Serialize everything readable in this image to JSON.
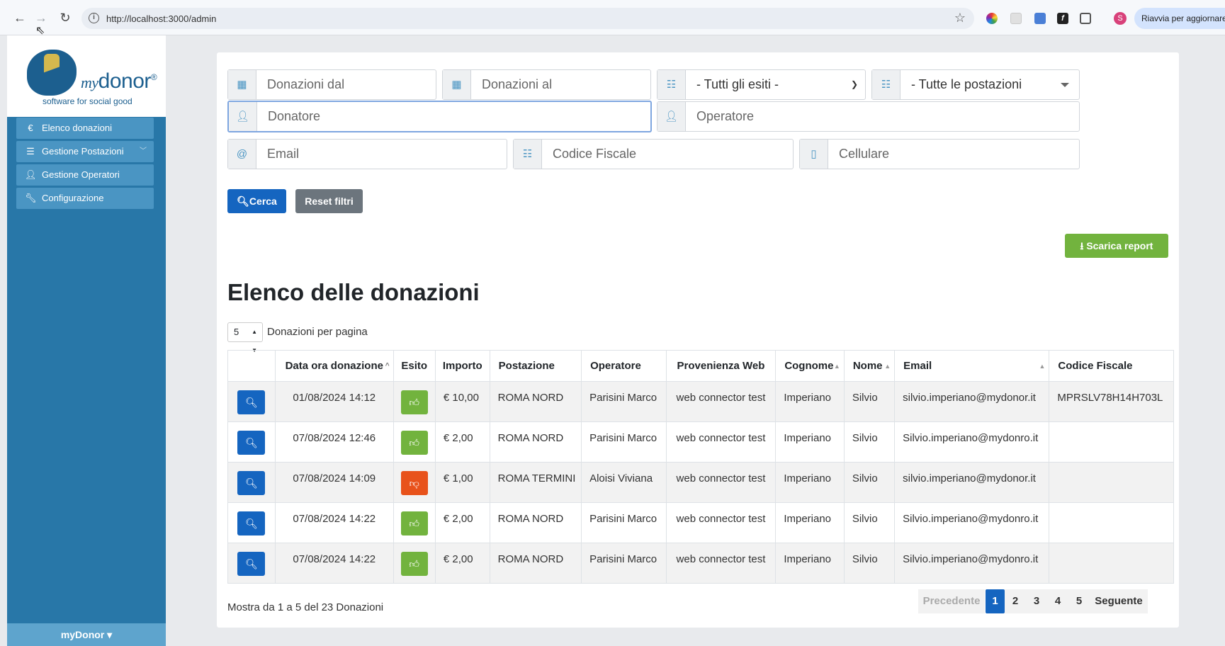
{
  "browser": {
    "url": "http://localhost:3000/admin",
    "relaunch_label": "Riavvia per aggiornare",
    "profile_initial": "S"
  },
  "sidebar": {
    "logo_my": "my",
    "logo_brand": "donor",
    "logo_mark": "®",
    "tagline": "software for social good",
    "items": [
      {
        "label": "Elenco donazioni",
        "icon": "euro-icon"
      },
      {
        "label": "Gestione Postazioni",
        "icon": "list-icon"
      },
      {
        "label": "Gestione Operatori",
        "icon": "user-icon"
      },
      {
        "label": "Configurazione",
        "icon": "wrench-icon"
      }
    ],
    "footer": "myDonor ▾"
  },
  "filters": {
    "date_from": "Donazioni dal",
    "date_to": "Donazioni al",
    "outcome_selected": "- Tutti gli esiti -",
    "station_selected": "- Tutte le postazioni",
    "donor_placeholder": "Donatore",
    "operator_placeholder": "Operatore",
    "email_placeholder": "Email",
    "tax_code_placeholder": "Codice Fiscale",
    "mobile_placeholder": "Cellulare",
    "search_label": "Cerca",
    "reset_label": "Reset filtri"
  },
  "report_label": "Scarica report",
  "title": "Elenco delle donazioni",
  "per_page": {
    "value": "5",
    "label": "Donazioni per pagina"
  },
  "table": {
    "headers": [
      "",
      "Data ora donazione",
      "Esito",
      "Importo",
      "Postazione",
      "Operatore",
      "Provenienza Web",
      "Cognome",
      "Nome",
      "Email",
      "Codice Fiscale"
    ],
    "rows": [
      {
        "date": "01/08/2024 14:12",
        "outcome": "ok",
        "amount": "€ 10,00",
        "station": "ROMA NORD",
        "operator": "Parisini Marco",
        "source": "web connector test",
        "surname": "Imperiano",
        "name": "Silvio",
        "email": "silvio.imperiano@mydonor.it",
        "tax_code": "MPRSLV78H14H703L"
      },
      {
        "date": "07/08/2024 12:46",
        "outcome": "ok",
        "amount": "€ 2,00",
        "station": "ROMA NORD",
        "operator": "Parisini Marco",
        "source": "web connector test",
        "surname": "Imperiano",
        "name": "Silvio",
        "email": "Silvio.imperiano@mydonro.it",
        "tax_code": ""
      },
      {
        "date": "07/08/2024 14:09",
        "outcome": "ko",
        "amount": "€ 1,00",
        "station": "ROMA TERMINI",
        "operator": "Aloisi Viviana",
        "source": "web connector test",
        "surname": "Imperiano",
        "name": "Silvio",
        "email": "silvio.imperiano@mydonor.it",
        "tax_code": ""
      },
      {
        "date": "07/08/2024 14:22",
        "outcome": "ok",
        "amount": "€ 2,00",
        "station": "ROMA NORD",
        "operator": "Parisini Marco",
        "source": "web connector test",
        "surname": "Imperiano",
        "name": "Silvio",
        "email": "Silvio.imperiano@mydonro.it",
        "tax_code": ""
      },
      {
        "date": "07/08/2024 14:22",
        "outcome": "ok",
        "amount": "€ 2,00",
        "station": "ROMA NORD",
        "operator": "Parisini Marco",
        "source": "web connector test",
        "surname": "Imperiano",
        "name": "Silvio",
        "email": "Silvio.imperiano@mydonro.it",
        "tax_code": ""
      }
    ]
  },
  "summary": "Mostra da 1 a 5 del 23 Donazioni",
  "pagination": {
    "prev": "Precedente",
    "pages": [
      "1",
      "2",
      "3",
      "4",
      "5"
    ],
    "active": "1",
    "next": "Seguente"
  },
  "colors": {
    "primary": "#1565c0",
    "success": "#72b33e",
    "danger": "#e8521b",
    "sidebar": "#2877a8"
  }
}
